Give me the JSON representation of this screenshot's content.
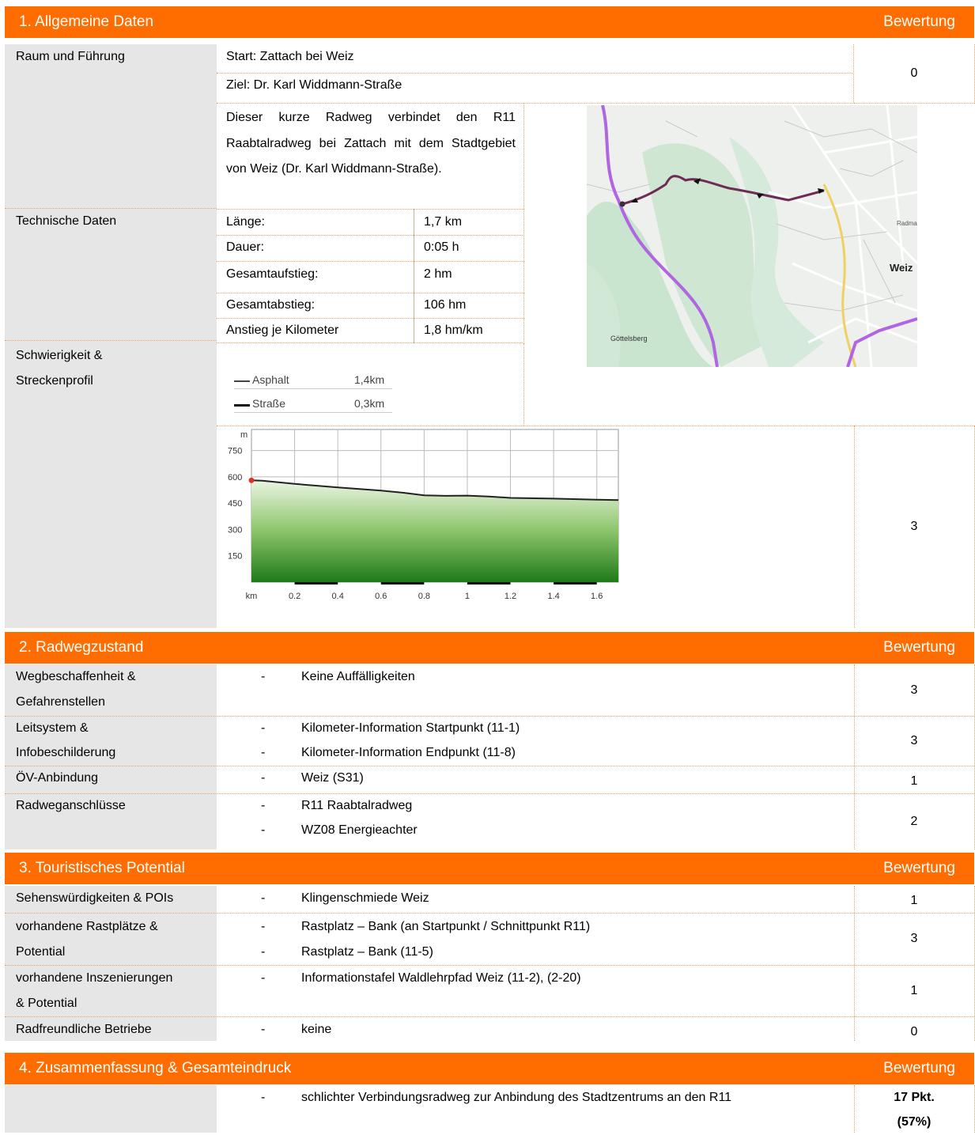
{
  "section1": {
    "title": "1. Allgemeine Daten",
    "rating_label": "Bewertung",
    "raum_label": "Raum und Führung",
    "start": "Start: Zattach bei Weiz",
    "ziel": "Ziel: Dr. Karl Widdmann-Straße",
    "score_raum": "0",
    "description": "Dieser kurze Radweg verbindet den R11 Raabtalradweg bei Zattach mit dem Stadtgebiet von Weiz (Dr. Karl Widdmann-Straße).",
    "tech_label": "Technische Daten",
    "tech": [
      {
        "k": "Länge:",
        "v": "1,7 km"
      },
      {
        "k": "Dauer:",
        "v": "0:05 h"
      },
      {
        "k": "Gesamtaufstieg:",
        "v": "2 hm"
      },
      {
        "k": "Gesamtabstieg:",
        "v": "106 hm"
      },
      {
        "k": "Anstieg je Kilometer",
        "v": "1,8 hm/km"
      }
    ],
    "schwierigkeit_label_1": "Schwierigkeit &",
    "schwierigkeit_label_2": "Streckenprofil",
    "surface": [
      {
        "name": "Asphalt",
        "value": "1,4km"
      },
      {
        "name": "Straße",
        "value": "0,3km"
      }
    ],
    "score_profil": "3",
    "map_labels": {
      "city": "Weiz",
      "place": "Göttelsberg",
      "radm": "Radmar"
    }
  },
  "chart_data": {
    "type": "area",
    "ylabel": "m",
    "xlabel": "km",
    "y_ticks": [
      "750",
      "600",
      "450",
      "300",
      "150"
    ],
    "x_ticks": [
      "0.2",
      "0.4",
      "0.6",
      "0.8",
      "1",
      "1.2",
      "1.4",
      "1.6"
    ],
    "ylim": [
      0,
      870
    ],
    "xlim": [
      0,
      1.7
    ],
    "x": [
      0,
      0.05,
      0.2,
      0.4,
      0.6,
      0.7,
      0.8,
      0.9,
      1.0,
      1.1,
      1.2,
      1.4,
      1.6,
      1.7
    ],
    "y": [
      580,
      578,
      560,
      540,
      522,
      510,
      495,
      492,
      493,
      488,
      480,
      476,
      470,
      468
    ],
    "grid": true
  },
  "section2": {
    "title": "2. Radwegzustand",
    "rating_label": "Bewertung",
    "rows": [
      {
        "label1": "Wegbeschaffenheit &",
        "label2": "Gefahrenstellen",
        "items": [
          "Keine Auffälligkeiten"
        ],
        "score": "3"
      },
      {
        "label1": "Leitsystem &",
        "label2": "Infobeschilderung",
        "items": [
          "Kilometer-Information Startpunkt (11-1)",
          "Kilometer-Information Endpunkt (11-8)"
        ],
        "score": "3"
      },
      {
        "label1": "ÖV-Anbindung",
        "label2": "",
        "items": [
          "Weiz (S31)"
        ],
        "score": "1"
      },
      {
        "label1": "Radweganschlüsse",
        "label2": "",
        "items": [
          "R11 Raabtalradweg",
          "WZ08 Energieachter"
        ],
        "score": "2"
      }
    ]
  },
  "section3": {
    "title": "3. Touristisches Potential",
    "rating_label": "Bewertung",
    "rows": [
      {
        "label1": "Sehenswürdigkeiten & POIs",
        "label2": "",
        "items": [
          "Klingenschmiede Weiz"
        ],
        "score": "1"
      },
      {
        "label1": "vorhandene Rastplätze &",
        "label2": "Potential",
        "items": [
          "Rastplatz – Bank (an Startpunkt / Schnittpunkt R11)",
          "Rastplatz – Bank (11-5)"
        ],
        "score": "3"
      },
      {
        "label1": "vorhandene Inszenierungen",
        "label2": "& Potential",
        "items": [
          "Informationstafel Waldlehrpfad Weiz (11-2), (2-20)"
        ],
        "score": "1"
      },
      {
        "label1": "Radfreundliche Betriebe",
        "label2": "",
        "items": [
          "keine"
        ],
        "score": "0"
      }
    ]
  },
  "section4": {
    "title": "4. Zusammenfassung & Gesamteindruck",
    "rating_label": "Bewertung",
    "item": "schlichter Verbindungsradweg zur Anbindung des Stadtzentrums an den R11",
    "score1": "17 Pkt.",
    "score2": "(57%)"
  },
  "dash": "-"
}
